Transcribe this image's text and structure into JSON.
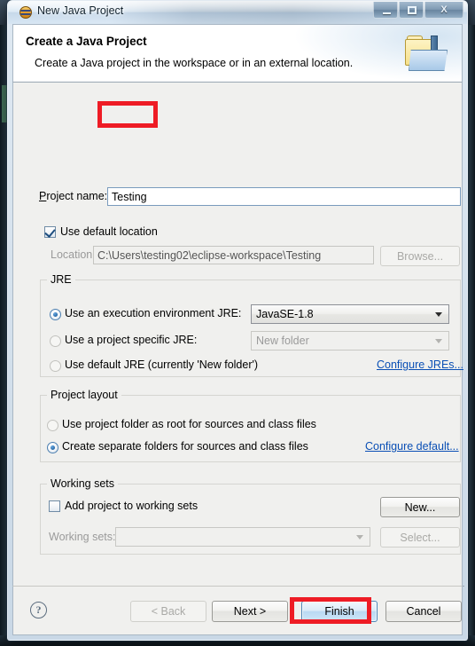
{
  "window": {
    "title": "New Java Project",
    "icon": "java-project-icon",
    "controls": {
      "minimize": "",
      "maximize": "",
      "close": "X"
    }
  },
  "header": {
    "title": "Create a Java Project",
    "description": "Create a Java project in the workspace or in an external location.",
    "icon": "new-java-project-banner-icon"
  },
  "form": {
    "project_name_label": "Project name:",
    "project_name_value": "Testing",
    "project_name_placeholder": "",
    "use_default_location_label": "Use default location",
    "use_default_location_checked": true,
    "location_label": "Location:",
    "location_value": "C:\\Users\\testing02\\eclipse-workspace\\Testing",
    "browse_label": "Browse..."
  },
  "jre": {
    "group_title": "JRE",
    "options": [
      {
        "label": "Use an execution environment JRE:",
        "selected": true
      },
      {
        "label": "Use a project specific JRE:",
        "selected": false
      },
      {
        "label": "Use default JRE (currently 'New folder')",
        "selected": false
      }
    ],
    "execution_env_value": "JavaSE-1.8",
    "project_jre_value": "New folder",
    "configure_link": "Configure JREs..."
  },
  "project_layout": {
    "group_title": "Project layout",
    "options": [
      {
        "label": "Use project folder as root for sources and class files",
        "selected": false
      },
      {
        "label": "Create separate folders for sources and class files",
        "selected": true
      }
    ],
    "configure_link": "Configure default..."
  },
  "working_sets": {
    "group_title": "Working sets",
    "add_label": "Add project to working sets",
    "add_checked": false,
    "sets_label": "Working sets:",
    "sets_value": "",
    "new_label": "New...",
    "select_label": "Select..."
  },
  "footer": {
    "help_label": "?",
    "back_label": "< Back",
    "next_label": "Next >",
    "finish_label": "Finish",
    "cancel_label": "Cancel"
  },
  "annotations": {
    "highlight_color": "#ee1c25",
    "boxes": [
      "project-name-value",
      "finish-button"
    ]
  }
}
